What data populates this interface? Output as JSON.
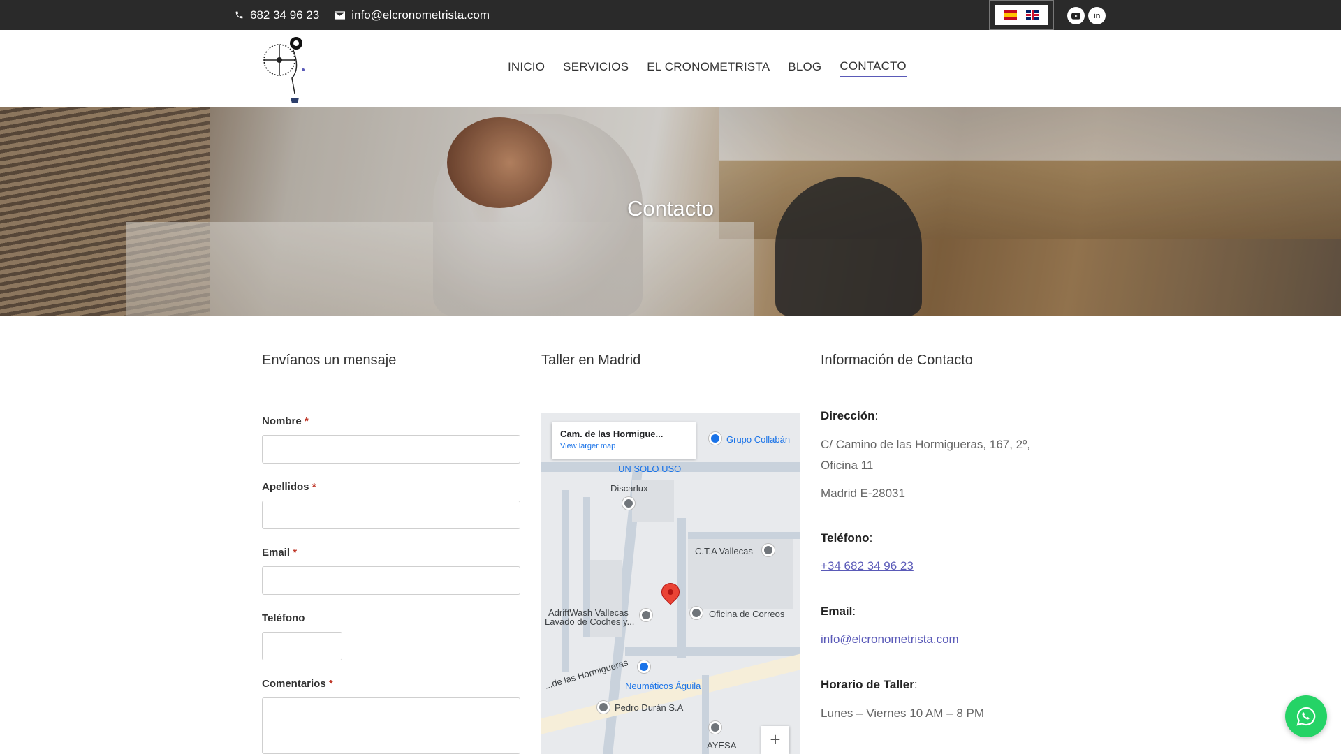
{
  "topbar": {
    "phone": "682 34 96 23",
    "email": "info@elcronometrista.com",
    "languages": [
      {
        "code": "es",
        "icon": "spain-flag-icon"
      },
      {
        "code": "en",
        "icon": "uk-flag-icon"
      }
    ],
    "social": [
      {
        "name": "youtube",
        "icon": "youtube-icon"
      },
      {
        "name": "linkedin",
        "icon": "linkedin-icon",
        "glyph": "in"
      }
    ]
  },
  "nav": {
    "items": [
      {
        "label": "INICIO"
      },
      {
        "label": "SERVICIOS"
      },
      {
        "label": "EL CRONOMETRISTA"
      },
      {
        "label": "BLOG"
      },
      {
        "label": "CONTACTO",
        "active": true
      }
    ]
  },
  "hero": {
    "title": "Contacto"
  },
  "form": {
    "title": "Envíanos un mensaje",
    "fields": [
      {
        "label": "Nombre",
        "required": true,
        "value": ""
      },
      {
        "label": "Apellidos",
        "required": true,
        "value": ""
      },
      {
        "label": "Email",
        "required": true,
        "value": ""
      },
      {
        "label": "Teléfono",
        "required": false,
        "value": ""
      },
      {
        "label": "Comentarios",
        "required": true,
        "value": ""
      }
    ],
    "required_mark": "*"
  },
  "map": {
    "title": "Taller en Madrid",
    "card_title": "Cam. de las Hormigue...",
    "card_link": "View larger map",
    "places": [
      {
        "name": "Grupo Collabán",
        "kind": "blue"
      },
      {
        "name": "UN SOLO USO",
        "kind": "blue"
      },
      {
        "name": "Discarlux",
        "kind": "grey"
      },
      {
        "name": "C.T.A Vallecas",
        "kind": "grey"
      },
      {
        "name": "AdriftWash Vallecas",
        "kind": "grey"
      },
      {
        "name": "Lavado de Coches y...",
        "kind": "grey"
      },
      {
        "name": "Oficina de Correos",
        "kind": "grey"
      },
      {
        "name": "...de las Hormigueras",
        "kind": "street"
      },
      {
        "name": "Neumáticos Águila",
        "kind": "blue"
      },
      {
        "name": "Pedro Durán S.A",
        "kind": "grey"
      },
      {
        "name": "AYESA",
        "kind": "grey"
      }
    ],
    "zoom_in": "+"
  },
  "contact_info": {
    "title": "Información de Contacto",
    "address_label": "Dirección",
    "address_line1": "C/ Camino de las Hormigueras, 167, 2º, Oficina 11",
    "address_line2": "Madrid E-28031",
    "phone_label": "Teléfono",
    "phone": "+34 682 34 96 23",
    "email_label": "Email",
    "email": "info@elcronometrista.com",
    "hours_label": "Horario de Taller",
    "hours": "Lunes – Viernes 10 AM – 8 PM",
    "colon": ":"
  },
  "colors": {
    "topbar_bg": "#2a2a2a",
    "accent": "#5a5ab8",
    "required": "#c0392b",
    "whatsapp": "#25d366"
  }
}
